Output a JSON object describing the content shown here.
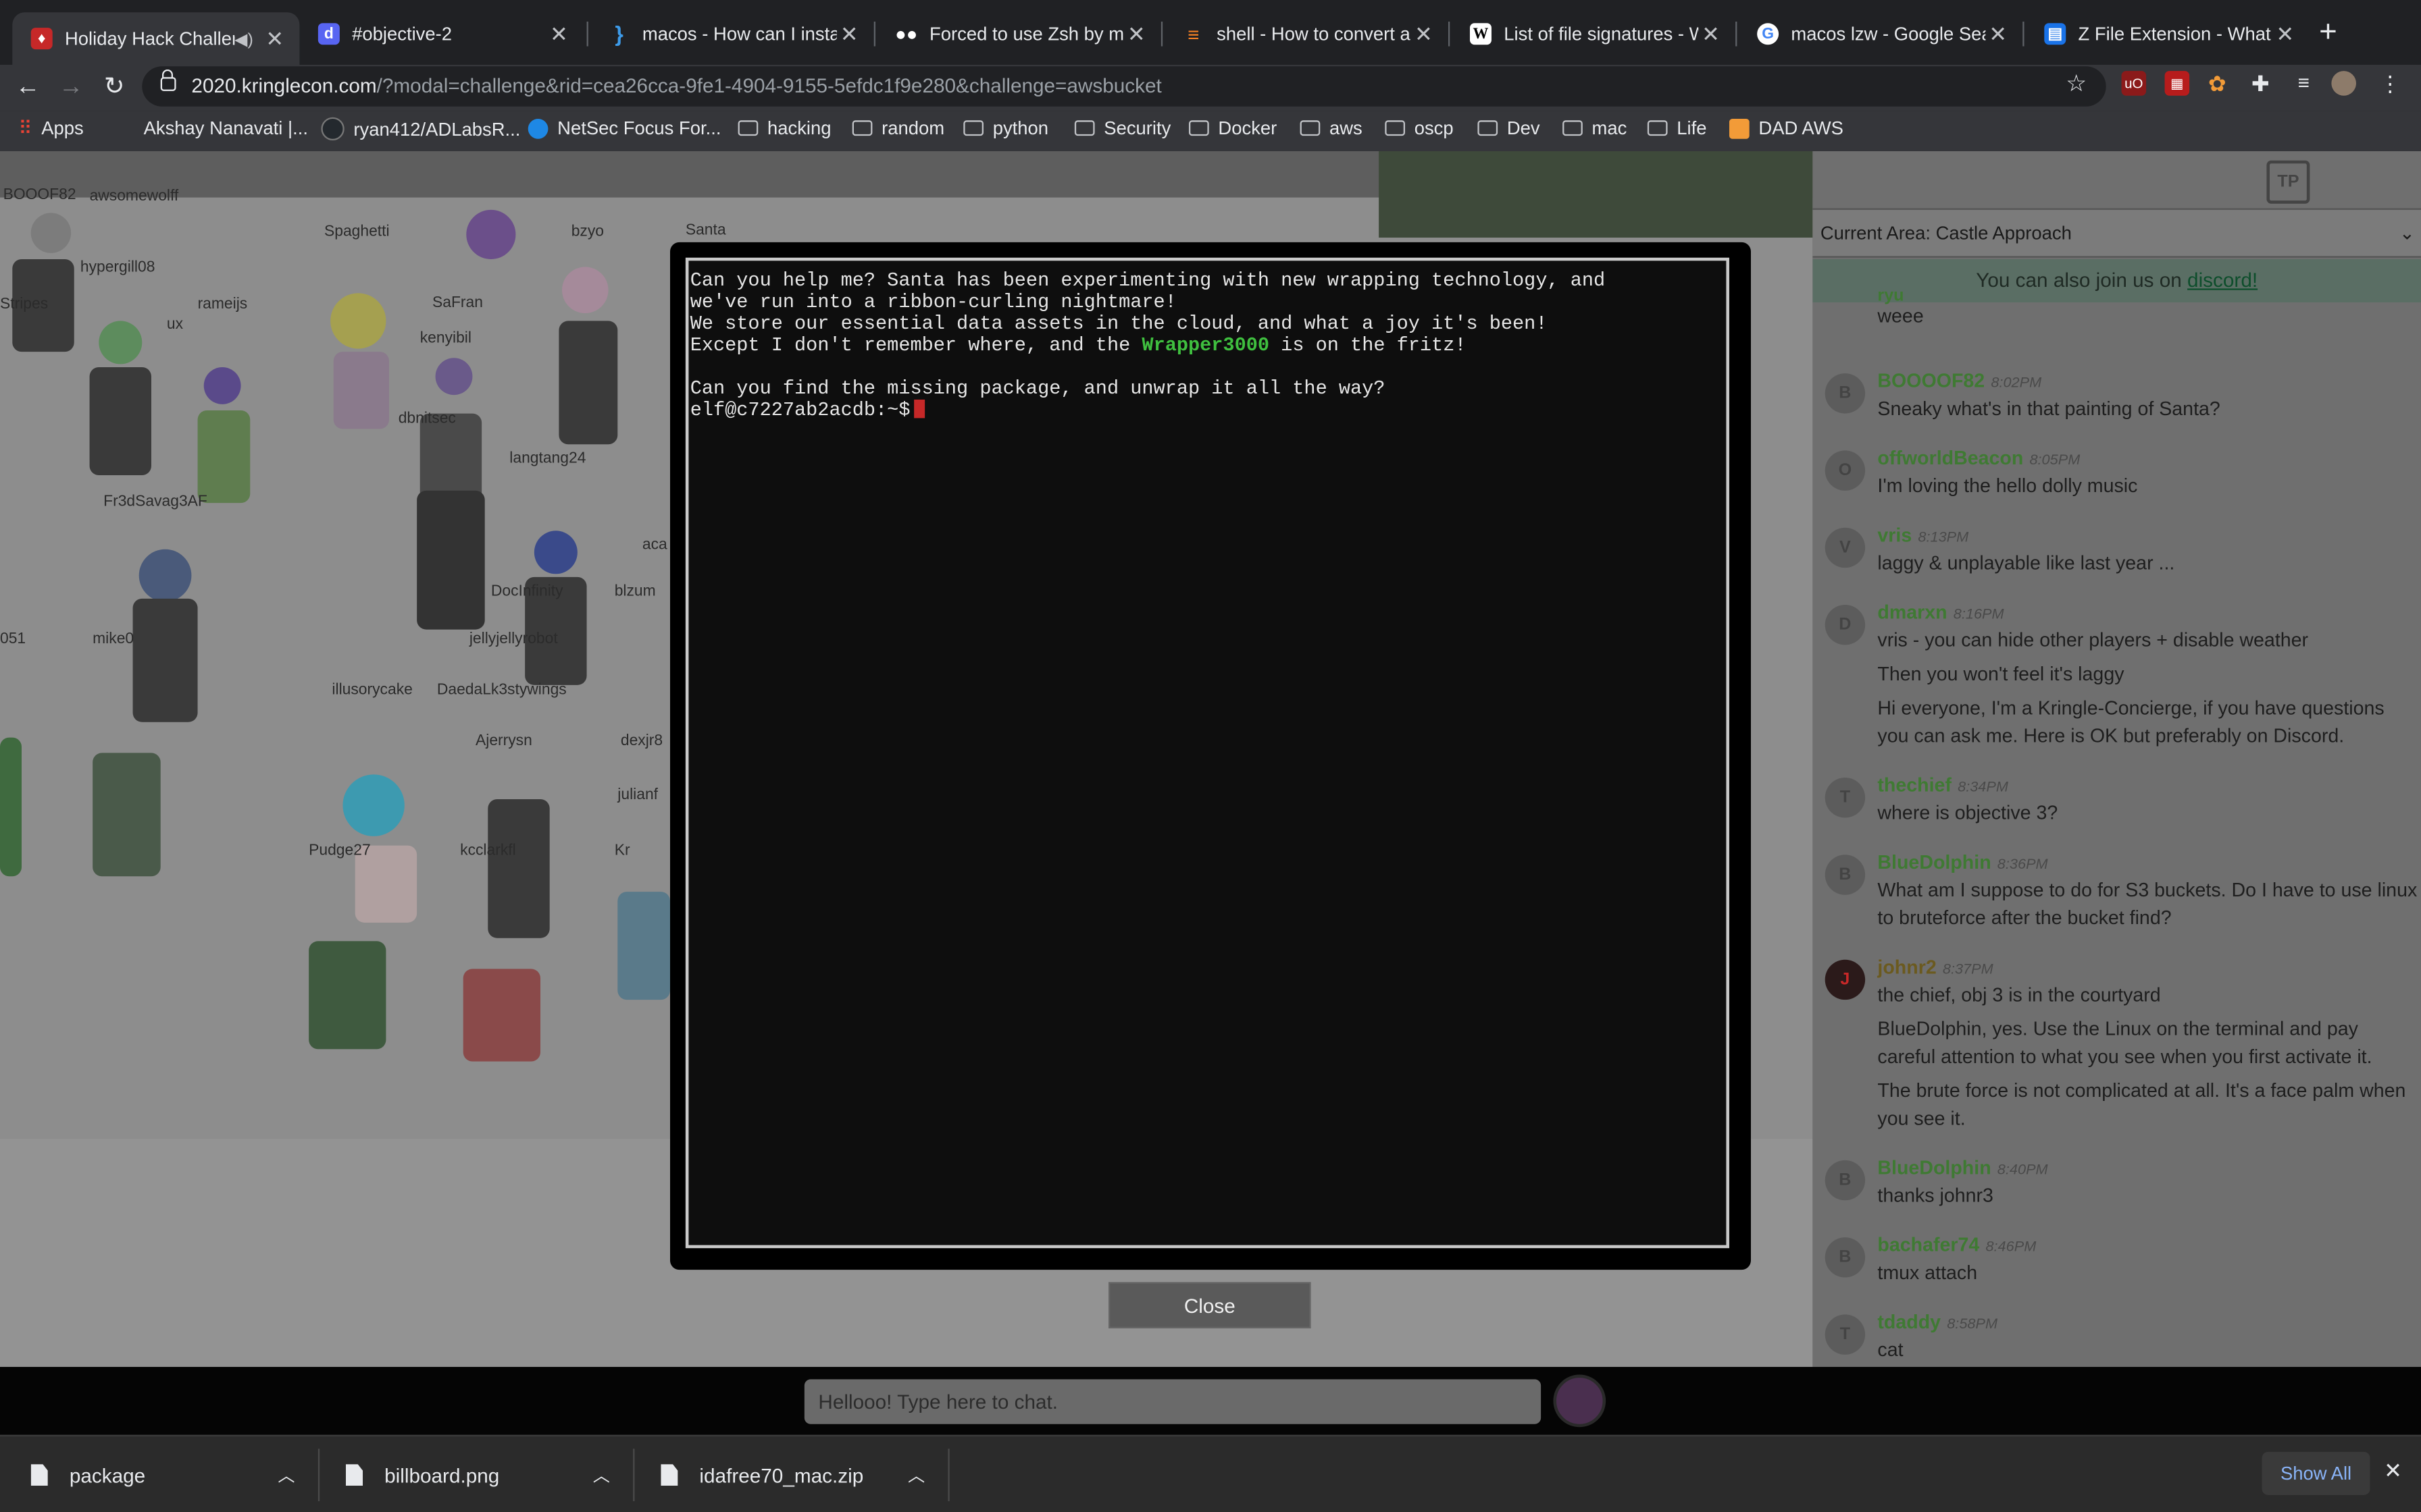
{
  "tabs": [
    {
      "title": "Holiday Hack Challeng",
      "active": true,
      "audio": true
    },
    {
      "title": "#objective-2"
    },
    {
      "title": "macos - How can I install"
    },
    {
      "title": "Forced to use Zsh by mac"
    },
    {
      "title": "shell - How to convert a t"
    },
    {
      "title": "List of file signatures - Wi"
    },
    {
      "title": "macos lzw - Google Searc"
    },
    {
      "title": "Z File Extension - What is"
    }
  ],
  "toolbar": {
    "url_host": "2020.kringlecon.com",
    "url_path": "/?modal=challenge&rid=cea26cca-9fe1-4904-9155-5efdc1f9e280&challenge=awsbucket"
  },
  "bookmarks": [
    "Apps",
    "Akshay Nanavati |...",
    "ryan412/ADLabsR...",
    "NetSec Focus For...",
    "hacking",
    "random",
    "python",
    "Security",
    "Docker",
    "aws",
    "oscp",
    "Dev",
    "mac",
    "Life",
    "DAD AWS"
  ],
  "game": {
    "player_names": [
      "BOOOF82",
      "awsomewolff",
      "hypergill08",
      "Spaghetti",
      "bzyo",
      "Santa",
      "Stripes",
      "rameijs",
      "SaFran",
      "kenyibil",
      "dbnitsec",
      "langtang24",
      "Fr3dSavag3AF",
      "mike0",
      "DocInfinity",
      "jellyjellyrobot",
      "blzum",
      "illusorycake",
      "DaedaLk3stywings",
      "Ajerrysn",
      "dexjr8",
      "julianf",
      "Pudge27",
      "kcclarkfl",
      "051",
      "aca",
      "Kr",
      "ux"
    ]
  },
  "terminal": {
    "lines": [
      "Can you help me? Santa has been experimenting with new wrapping technology, and",
      "we've run into a ribbon-curling nightmare!",
      "We store our essential data assets in the cloud, and what a joy it's been!"
    ],
    "line4_pre": "Except I don't remember where, and the ",
    "line4_hl": "Wrapper3000",
    "line4_post": " is on the fritz!",
    "line6": "Can you find the missing package, and unwrap it all the way?",
    "prompt": "elf@c7227ab2acdb:~$"
  },
  "modal": {
    "close_label": "Close"
  },
  "chat": {
    "area_label": "Current Area: Castle Approach",
    "discord_pre": "You can also join us on ",
    "discord_link": "discord!",
    "top_partial_name": "ryu",
    "top_partial_text": "weee",
    "messages": [
      {
        "initial": "B",
        "name": "BOOOOF82",
        "time": "8:02PM",
        "lines": [
          "Sneaky what's in that painting of Santa?"
        ]
      },
      {
        "initial": "O",
        "name": "offworldBeacon",
        "time": "8:05PM",
        "lines": [
          "I'm loving the hello dolly music"
        ]
      },
      {
        "initial": "V",
        "name": "vris",
        "time": "8:13PM",
        "lines": [
          "laggy & unplayable like last year ..."
        ]
      },
      {
        "initial": "D",
        "name": "dmarxn",
        "time": "8:16PM",
        "lines": [
          "vris - you can hide other players + disable weather",
          "Then you won't feel it's laggy",
          "Hi everyone, I'm a Kringle-Concierge, if you have questions you can ask me. Here is OK but preferably on Discord."
        ]
      },
      {
        "initial": "T",
        "name": "thechief",
        "time": "8:34PM",
        "lines": [
          "where is objective 3?"
        ]
      },
      {
        "initial": "B",
        "name": "BlueDolphin",
        "time": "8:36PM",
        "lines": [
          "What am I suppose to do for S3 buckets. Do I have to use linux to bruteforce after the bucket find?"
        ]
      },
      {
        "initial": "J",
        "name": "johnr2",
        "time": "8:37PM",
        "lines": [
          "the chief, obj 3 is in the courtyard",
          "BlueDolphin, yes. Use the Linux on the terminal and pay careful attention to what you see when you first activate it.",
          "The brute force is not complicated at all. It's a face palm when you see it."
        ]
      },
      {
        "initial": "B",
        "name": "BlueDolphin",
        "time": "8:40PM",
        "lines": [
          "thanks johnr3"
        ]
      },
      {
        "initial": "B",
        "name": "bachafer74",
        "time": "8:46PM",
        "lines": [
          "tmux attach"
        ]
      },
      {
        "initial": "T",
        "name": "tdaddy",
        "time": "8:58PM",
        "lines": [
          "cat"
        ]
      }
    ],
    "input_placeholder": "Hellooo! Type here to chat."
  },
  "downloads": {
    "items": [
      "package",
      "billboard.png",
      "idafree70_mac.zip"
    ],
    "show_all": "Show All"
  }
}
